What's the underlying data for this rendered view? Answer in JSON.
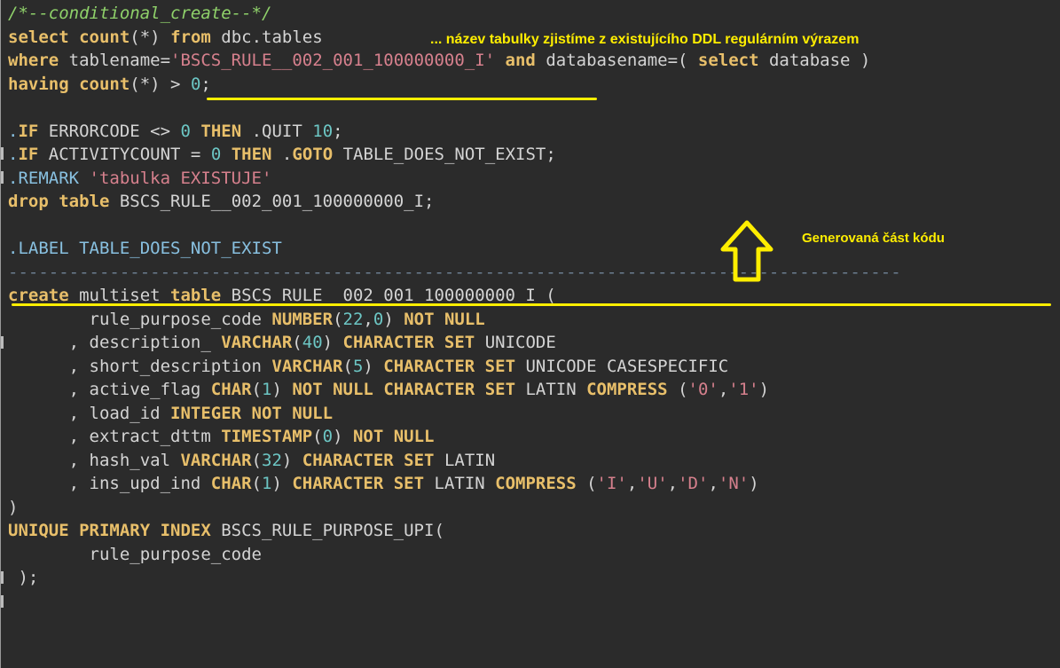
{
  "annotations": {
    "top_note": "... název tabulky zjistíme z existujícího DDL regulárním výrazem",
    "generated_note": "Generovaná část kódu"
  },
  "colors": {
    "background": "#2b2b2b",
    "keyword": "#e8bf6a",
    "number": "#6cc6c4",
    "string": "#d6808d",
    "comment": "#8fd16a",
    "dot_command": "#88c0e0",
    "annotation": "#ffee00"
  },
  "icons": {
    "arrow": "up-arrow-outline-icon"
  },
  "code": {
    "l1": [
      "/*--conditional_create--*/"
    ],
    "l2": [
      "select",
      " ",
      "count",
      "(*) ",
      "from",
      " dbc.tables"
    ],
    "l3": [
      "where",
      " tablename=",
      "'BSCS_RULE__002_001_100000000_I'",
      " ",
      "and",
      " databasename=( ",
      "select",
      " database )"
    ],
    "l4": [
      "having",
      " ",
      "count",
      "(*) > ",
      "0",
      ";"
    ],
    "l5": [
      ""
    ],
    "l6": [
      ".",
      "IF",
      " ERRORCODE <> ",
      "0",
      " ",
      "THEN",
      " .QUIT ",
      "10",
      ";"
    ],
    "l7": [
      ".",
      "IF",
      " ACTIVITYCOUNT = ",
      "0",
      " ",
      "THEN",
      " .",
      "GOTO",
      " TABLE_DOES_NOT_EXIST;"
    ],
    "l8": [
      ".REMARK ",
      "'tabulka EXISTUJE'"
    ],
    "l9": [
      "drop",
      " ",
      "table",
      " BSCS_RULE__002_001_100000000_I;"
    ],
    "l10": [
      ""
    ],
    "l11": [
      ".LABEL TABLE_DOES_NOT_EXIST"
    ],
    "l12": [
      "----------------------------------------------------------------------------------------"
    ],
    "l13": [
      "create",
      " multiset ",
      "table",
      " BSCS_RULE__002_001_100000000_I ("
    ],
    "l14": [
      "        rule_purpose_code ",
      "NUMBER",
      "(",
      "22",
      ",",
      "0",
      ") ",
      "NOT NULL"
    ],
    "l15": [
      "      , description_ ",
      "VARCHAR",
      "(",
      "40",
      ") ",
      "CHARACTER SET",
      " UNICODE"
    ],
    "l16": [
      "      , short_description ",
      "VARCHAR",
      "(",
      "5",
      ") ",
      "CHARACTER SET",
      " UNICODE CASESPECIFIC"
    ],
    "l17": [
      "      , active_flag ",
      "CHAR",
      "(",
      "1",
      ") ",
      "NOT NULL",
      " ",
      "CHARACTER SET",
      " LATIN ",
      "COMPRESS",
      " (",
      "'0'",
      ",",
      "'1'",
      ")"
    ],
    "l18": [
      "      , load_id ",
      "INTEGER NOT NULL"
    ],
    "l19": [
      "      , extract_dttm ",
      "TIMESTAMP",
      "(",
      "0",
      ") ",
      "NOT NULL"
    ],
    "l20": [
      "      , hash_val ",
      "VARCHAR",
      "(",
      "32",
      ") ",
      "CHARACTER SET",
      " LATIN"
    ],
    "l21": [
      "      , ins_upd_ind ",
      "CHAR",
      "(",
      "1",
      ") ",
      "CHARACTER SET",
      " LATIN ",
      "COMPRESS",
      " (",
      "'I'",
      ",",
      "'U'",
      ",",
      "'D'",
      ",",
      "'N'",
      ")"
    ],
    "l22": [
      ")"
    ],
    "l23": [
      "UNIQUE PRIMARY INDEX",
      " BSCS_RULE_PURPOSE_UPI("
    ],
    "l24": [
      "        rule_purpose_code"
    ],
    "l25": [
      " );"
    ]
  }
}
